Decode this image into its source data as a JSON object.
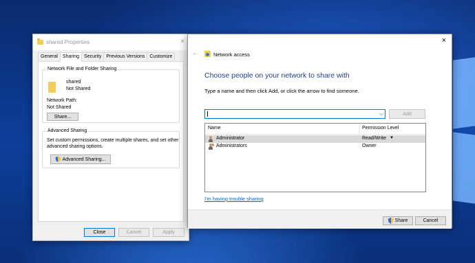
{
  "props_dialog": {
    "title": "shared Properties",
    "close": "×",
    "tabs": [
      "General",
      "Sharing",
      "Security",
      "Previous Versions",
      "Customize"
    ],
    "nffs": {
      "group_title": "Network File and Folder Sharing",
      "folder_name": "shared",
      "folder_status": "Not Shared",
      "network_path_label": "Network Path:",
      "network_path_value": "Not Shared",
      "share_button": "Share..."
    },
    "advanced": {
      "group_title": "Advanced Sharing",
      "description_line1": "Set custom permissions, create multiple shares, and set other",
      "description_line2": "advanced sharing options.",
      "button": "Advanced Sharing..."
    },
    "footer": {
      "close": "Close",
      "cancel": "Cancel",
      "apply": "Apply"
    }
  },
  "network_dialog": {
    "title": "Network access",
    "close": "×",
    "back": "←",
    "heading": "Choose people on your network to share with",
    "instruction": "Type a name and then click Add, or click the arrow to find someone.",
    "input_value": "",
    "combo_arrow": "⌵",
    "add_button": "Add",
    "columns": {
      "name": "Name",
      "permission": "Permission Level"
    },
    "rows": [
      {
        "name": "Administrator",
        "permission": "Read/Write",
        "dropdown": "▼"
      },
      {
        "name": "Administrators",
        "permission": "Owner"
      }
    ],
    "trouble_link": "I'm having trouble sharing",
    "share_button": "Share",
    "cancel_button": "Cancel"
  }
}
